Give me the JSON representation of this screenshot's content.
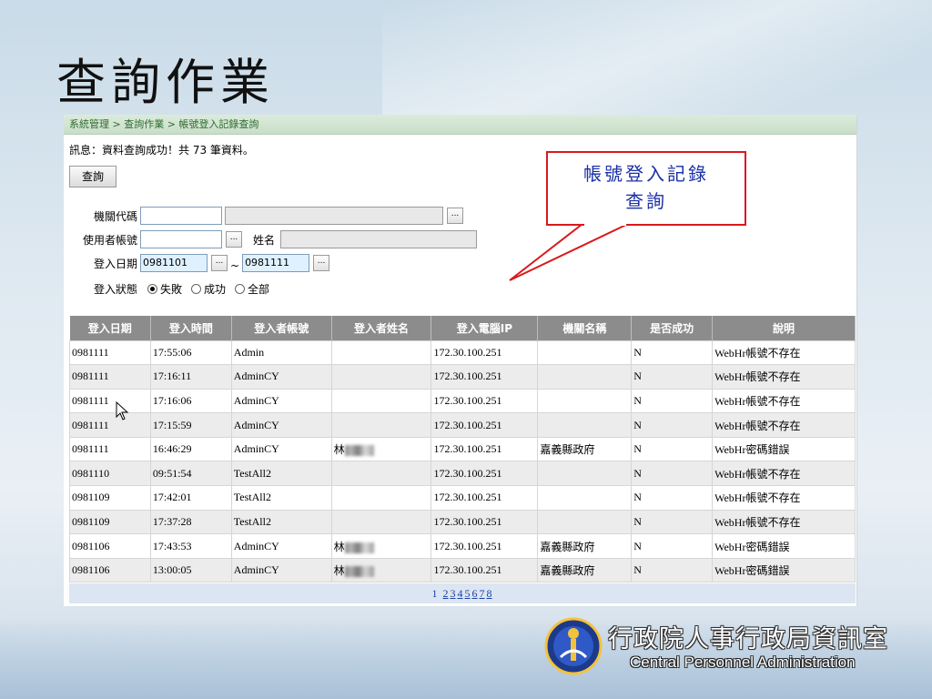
{
  "slide": {
    "title": "查詢作業"
  },
  "app": {
    "breadcrumb": "系統管理 > 查詢作業 > 帳號登入記錄查詢",
    "message": "訊息：資料查詢成功！共 73 筆資料。",
    "query_button": "查詢",
    "form": {
      "agency_code_label": "機關代碼",
      "agency_code_value": "",
      "agency_name_value": "",
      "user_account_label": "使用者帳號",
      "user_account_value": "",
      "name_label": "姓名",
      "name_value": "",
      "login_date_label": "登入日期",
      "date_from": "0981101",
      "date_sep": "~",
      "date_to": "0981111",
      "status_label": "登入狀態",
      "status_options": [
        "失敗",
        "成功",
        "全部"
      ],
      "status_selected": "失敗",
      "dots": "..."
    },
    "table": {
      "headers": [
        "登入日期",
        "登入時間",
        "登入者帳號",
        "登入者姓名",
        "登入電腦IP",
        "機關名稱",
        "是否成功",
        "說明"
      ],
      "rows": [
        [
          "0981111",
          "17:55:06",
          "Admin",
          "",
          "172.30.100.251",
          "",
          "N",
          "WebHr帳號不存在"
        ],
        [
          "0981111",
          "17:16:11",
          "AdminCY",
          "",
          "172.30.100.251",
          "",
          "N",
          "WebHr帳號不存在"
        ],
        [
          "0981111",
          "17:16:06",
          "AdminCY",
          "",
          "172.30.100.251",
          "",
          "N",
          "WebHr帳號不存在"
        ],
        [
          "0981111",
          "17:15:59",
          "AdminCY",
          "",
          "172.30.100.251",
          "",
          "N",
          "WebHr帳號不存在"
        ],
        [
          "0981111",
          "16:46:29",
          "AdminCY",
          "林",
          "172.30.100.251",
          "嘉義縣政府",
          "N",
          "WebHr密碼錯誤"
        ],
        [
          "0981110",
          "09:51:54",
          "TestAll2",
          "",
          "172.30.100.251",
          "",
          "N",
          "WebHr帳號不存在"
        ],
        [
          "0981109",
          "17:42:01",
          "TestAll2",
          "",
          "172.30.100.251",
          "",
          "N",
          "WebHr帳號不存在"
        ],
        [
          "0981109",
          "17:37:28",
          "TestAll2",
          "",
          "172.30.100.251",
          "",
          "N",
          "WebHr帳號不存在"
        ],
        [
          "0981106",
          "17:43:53",
          "AdminCY",
          "林",
          "172.30.100.251",
          "嘉義縣政府",
          "N",
          "WebHr密碼錯誤"
        ],
        [
          "0981106",
          "13:00:05",
          "AdminCY",
          "林",
          "172.30.100.251",
          "嘉義縣政府",
          "N",
          "WebHr密碼錯誤"
        ]
      ]
    },
    "pager": {
      "current": "1",
      "pages": [
        "2",
        "3",
        "4",
        "5",
        "6",
        "7",
        "8"
      ]
    }
  },
  "callout": {
    "line1": "帳號登入記錄",
    "line2": "查詢",
    "border_color": "#d9191c"
  },
  "footer": {
    "org_cn": "行政院人事行政局資訊室",
    "org_en": "Central Personnel Administration",
    "emblem_icon": "cpa-emblem-icon"
  }
}
